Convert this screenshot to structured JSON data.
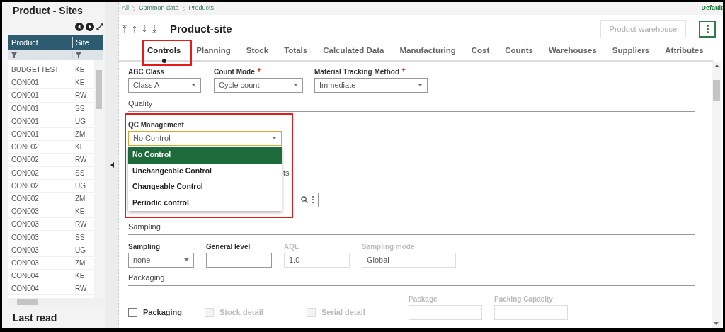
{
  "sidebar": {
    "title": "Product - Sites",
    "columns": [
      "Product",
      "Site"
    ],
    "rows": [
      [
        "BUDGETTEST",
        "KE"
      ],
      [
        "CON001",
        "KE"
      ],
      [
        "CON001",
        "RW"
      ],
      [
        "CON001",
        "SS"
      ],
      [
        "CON001",
        "UG"
      ],
      [
        "CON001",
        "ZM"
      ],
      [
        "CON002",
        "KE"
      ],
      [
        "CON002",
        "RW"
      ],
      [
        "CON002",
        "SS"
      ],
      [
        "CON002",
        "UG"
      ],
      [
        "CON002",
        "ZM"
      ],
      [
        "CON003",
        "KE"
      ],
      [
        "CON003",
        "RW"
      ],
      [
        "CON003",
        "SS"
      ],
      [
        "CON003",
        "UG"
      ],
      [
        "CON003",
        "ZM"
      ],
      [
        "CON004",
        "KE"
      ],
      [
        "CON004",
        "RW"
      ]
    ],
    "footer": "Last read"
  },
  "breadcrumb": [
    "All",
    "Common data",
    "Products"
  ],
  "user": "Default",
  "page_title": "Product-site",
  "header_button": "Product-warehouse",
  "tabs": [
    {
      "label": "Controls",
      "selected": true
    },
    {
      "label": "Planning",
      "selected": false
    },
    {
      "label": "Stock",
      "selected": false
    },
    {
      "label": "Totals",
      "selected": false
    },
    {
      "label": "Calculated Data",
      "selected": false
    },
    {
      "label": "Manufacturing",
      "selected": false
    },
    {
      "label": "Cost",
      "selected": false
    },
    {
      "label": "Counts",
      "selected": false
    },
    {
      "label": "Warehouses",
      "selected": false
    },
    {
      "label": "Suppliers",
      "selected": false
    },
    {
      "label": "Attributes",
      "selected": false
    }
  ],
  "top_fields": [
    {
      "label": "ABC Class",
      "required": false,
      "value": "Class A"
    },
    {
      "label": "Count Mode",
      "required": true,
      "value": "Cycle count"
    },
    {
      "label": "Material Tracking Method",
      "required": true,
      "value": "Immediate"
    }
  ],
  "quality": {
    "heading": "Quality",
    "qc_label": "QC Management",
    "qc_value": "No Control",
    "hidden_label": "ts",
    "options": [
      {
        "label": "No Control",
        "selected": true
      },
      {
        "label": "Unchangeable Control",
        "selected": false
      },
      {
        "label": "Changeable Control",
        "selected": false
      },
      {
        "label": "Periodic control",
        "selected": false
      }
    ]
  },
  "sampling": {
    "heading": "Sampling",
    "fields": [
      {
        "label": "Sampling",
        "value": "none",
        "kind": "select",
        "disabled": false
      },
      {
        "label": "General level",
        "kind": "text",
        "disabled": false
      },
      {
        "label": "AQL",
        "value": "1.0",
        "kind": "text",
        "disabled": true
      },
      {
        "label": "Sampling mode",
        "value": "Global",
        "kind": "text",
        "disabled": true
      }
    ]
  },
  "packaging": {
    "heading": "Packaging",
    "checkboxes": [
      {
        "label": "Packaging",
        "checked": false,
        "disabled": false
      },
      {
        "label": "Stock detail",
        "checked": false,
        "disabled": true
      },
      {
        "label": "Serial detail",
        "checked": false,
        "disabled": true
      }
    ],
    "fields": [
      {
        "label": "Package",
        "disabled": true
      },
      {
        "label": "Packing Capacity",
        "disabled": true
      }
    ]
  }
}
